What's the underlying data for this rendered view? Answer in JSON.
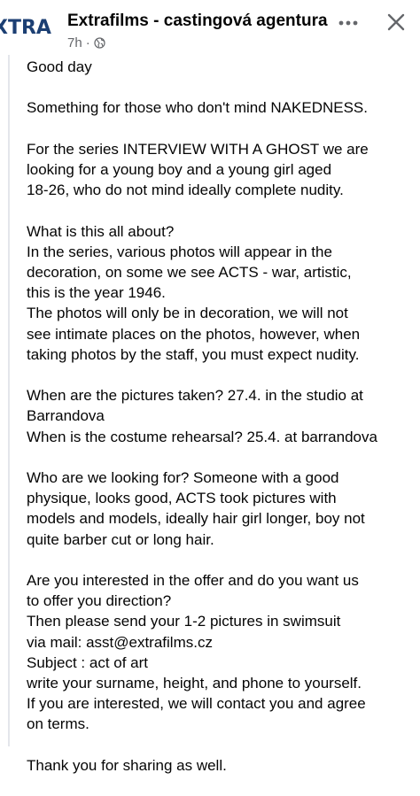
{
  "post": {
    "page_avatar_text": "XTRA",
    "page_name": "Extrafilms - castingová agentura",
    "time": "7h",
    "visibility_icon": "globe-icon",
    "more_icon": "more-dots-icon",
    "close_icon": "close-icon"
  },
  "body": {
    "paragraphs": [
      {
        "lines": [
          "Good day"
        ]
      },
      {
        "lines": [
          "Something for those who don't mind NAKEDNESS."
        ]
      },
      {
        "lines": [
          "For the series INTERVIEW WITH A GHOST we are",
          "looking for a young boy and a young girl aged",
          "18-26, who do not mind ideally complete nudity."
        ]
      },
      {
        "lines": [
          "What is this all about?",
          "In the series, various photos will appear in the",
          "decoration, on some we see ACTS - war, artistic,",
          "this is the year 1946.",
          "The photos will only be in decoration, we will not",
          "see intimate places on the photos, however, when",
          "taking photos by the staff, you must expect nudity."
        ]
      },
      {
        "lines": [
          "When are the pictures taken? 27.4. in the studio at",
          "Barrandova",
          "When is the costume rehearsal? 25.4. at barrandova"
        ]
      },
      {
        "lines": [
          "Who are we looking for? Someone with a good",
          "physique, looks good, ACTS took pictures with",
          "models and models, ideally hair girl longer, boy not",
          "quite barber cut or long hair."
        ]
      },
      {
        "lines": [
          "Are you interested in the offer and do you want us",
          "to offer you direction?",
          "Then please send your 1-2 pictures in swimsuit",
          "via mail: asst@extrafilms.cz",
          "Subject : act of art",
          "write your surname, height, and phone to yourself.",
          "If you are interested, we will contact you and agree",
          "on terms."
        ]
      },
      {
        "lines": [
          "Thank you for sharing as well."
        ]
      }
    ]
  },
  "colors": {
    "text": "#050505",
    "secondary_text": "#65676b",
    "avatar_brand": "#1c3f73",
    "quote_bar": "#e4e6eb"
  }
}
